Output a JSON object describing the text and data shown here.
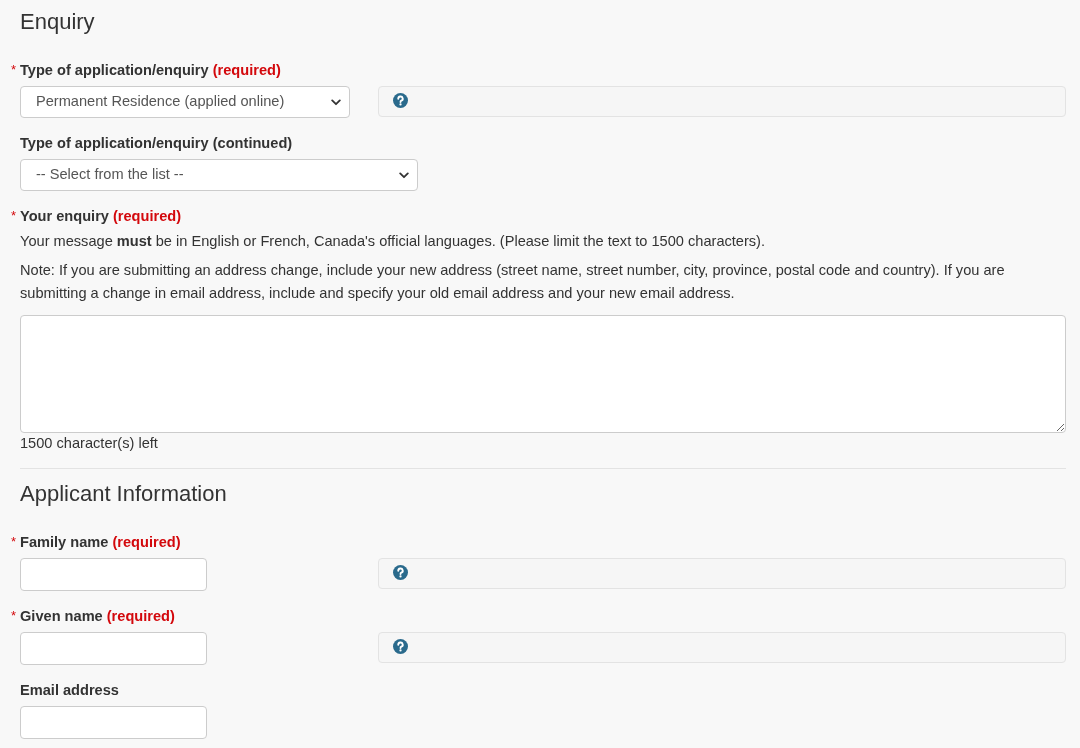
{
  "sections": [
    {
      "title": "Enquiry",
      "fields": [
        {
          "kind": "select",
          "marker": "*",
          "label": "Type of application/enquiry",
          "required": "(required)",
          "value": "Permanent Residence (applied online)",
          "help": true
        },
        {
          "kind": "select",
          "label": "Type of application/enquiry (continued)",
          "value": "-- Select from the list --",
          "help": false
        },
        {
          "kind": "textarea",
          "marker": "*",
          "label": "Your enquiry",
          "required": "(required)",
          "notes": [
            "Your message **must** be in English or French, Canada's official languages. (Please limit the text to 1500 characters).",
            "Note: If you are submitting an address change, include your new address (street name, street number, city, province, postal code and country). If you are submitting a change in email address, include and specify your old email address and your new email address."
          ],
          "counter": "1500 character(s) left",
          "help": false
        }
      ]
    },
    {
      "title": "Applicant Information",
      "fields": [
        {
          "kind": "text",
          "marker": "*",
          "label": "Family name",
          "required": "(required)",
          "help": true
        },
        {
          "kind": "text",
          "marker": "*",
          "label": "Given name",
          "required": "(required)",
          "help": true
        },
        {
          "kind": "text",
          "label": "Email address",
          "help": false
        }
      ]
    }
  ]
}
